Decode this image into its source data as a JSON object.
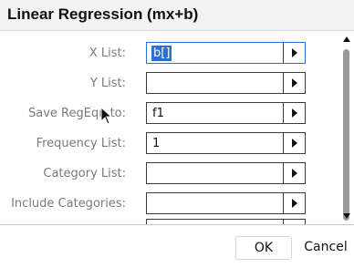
{
  "dialog": {
    "title": "Linear Regression (mx+b)",
    "fields": [
      {
        "label": "X List:",
        "value": "b[]"
      },
      {
        "label": "Y List:",
        "value": ""
      },
      {
        "label": "Save RegEqn to:",
        "value": "f1"
      },
      {
        "label": "Frequency List:",
        "value": "1"
      },
      {
        "label": "Category List:",
        "value": ""
      },
      {
        "label": "Include Categories:",
        "value": ""
      }
    ],
    "buttons": {
      "ok": "OK",
      "cancel": "Cancel"
    }
  }
}
